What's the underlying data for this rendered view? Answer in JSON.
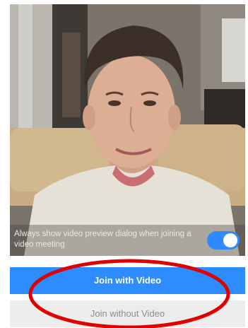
{
  "preview": {
    "toggle_label": "Always show video preview dialog when joining a video meeting",
    "toggle_on": true
  },
  "buttons": {
    "join_with_video": "Join with Video",
    "join_without_video": "Join without Video"
  },
  "colors": {
    "accent": "#2d8cff",
    "toggle_on": "#2e8bff",
    "secondary_button": "#ececec",
    "annotation_ring": "#e00000"
  }
}
